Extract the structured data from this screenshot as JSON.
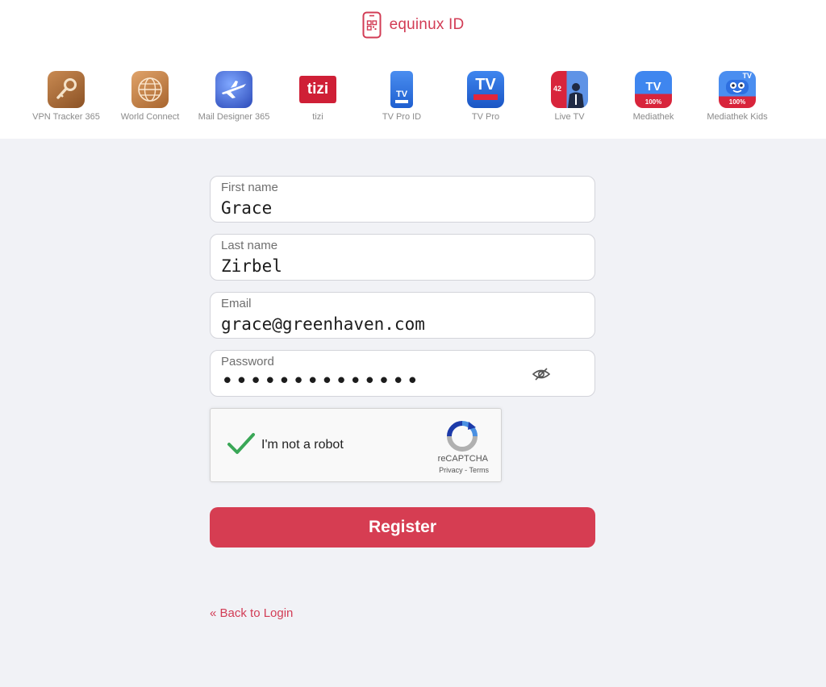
{
  "header": {
    "brand": "equinux ID",
    "brand_color": "#d23c55"
  },
  "apps": [
    {
      "label": "VPN Tracker 365",
      "icon": "key-icon"
    },
    {
      "label": "World Connect",
      "icon": "globe-icon"
    },
    {
      "label": "Mail Designer 365",
      "icon": "airplane-icon"
    },
    {
      "label": "tizi",
      "icon": "tizi-logo-icon",
      "icon_text": "tizi"
    },
    {
      "label": "TV Pro ID",
      "icon": "phone-tv-icon",
      "icon_text": "TV"
    },
    {
      "label": "TV Pro",
      "icon": "tv-pro-icon",
      "icon_text": "TV"
    },
    {
      "label": "Live TV",
      "icon": "live-tv-icon",
      "icon_text": "42"
    },
    {
      "label": "Mediathek",
      "icon": "mediathek-icon",
      "icon_text": "TV",
      "badge": "100%"
    },
    {
      "label": "Mediathek Kids",
      "icon": "mediathek-kids-icon",
      "icon_text": "TV",
      "badge": "100%"
    }
  ],
  "form": {
    "first_name": {
      "label": "First name",
      "value": "Grace"
    },
    "last_name": {
      "label": "Last name",
      "value": "Zirbel"
    },
    "email": {
      "label": "Email",
      "value": "grace@greenhaven.com"
    },
    "password": {
      "label": "Password",
      "value": "••••••••••••••"
    },
    "captcha": {
      "text": "I'm not a robot",
      "brand": "reCAPTCHA",
      "links": "Privacy - Terms"
    },
    "register_label": "Register",
    "back_label": "« Back to Login",
    "accent": "#d63d52"
  }
}
